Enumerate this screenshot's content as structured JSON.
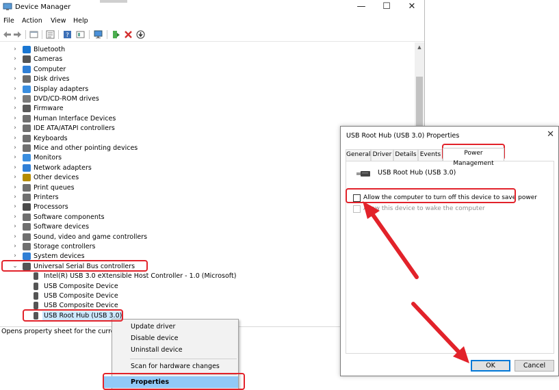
{
  "window": {
    "title": "Device Manager",
    "controls": {
      "minimize": "—",
      "maximize": "☐",
      "close": "✕"
    }
  },
  "menu": [
    "File",
    "Action",
    "View",
    "Help"
  ],
  "toolbar_icons": [
    "back-icon",
    "forward-icon",
    "view-icon",
    "properties-icon",
    "help-icon",
    "console-icon",
    "monitor-icon",
    "update-driver-icon",
    "uninstall-icon",
    "download-icon"
  ],
  "tree": {
    "categories": [
      {
        "label": "Bluetooth",
        "icon": "bluetooth-icon",
        "color": "#1976d2"
      },
      {
        "label": "Cameras",
        "icon": "camera-icon",
        "color": "#555555"
      },
      {
        "label": "Computer",
        "icon": "computer-icon",
        "color": "#2f7fd6"
      },
      {
        "label": "Disk drives",
        "icon": "disk-icon",
        "color": "#6b6b6b"
      },
      {
        "label": "Display adapters",
        "icon": "display-icon",
        "color": "#3a8ee0"
      },
      {
        "label": "DVD/CD-ROM drives",
        "icon": "dvd-icon",
        "color": "#7a7a7a"
      },
      {
        "label": "Firmware",
        "icon": "firmware-icon",
        "color": "#5a5a5a"
      },
      {
        "label": "Human Interface Devices",
        "icon": "hid-icon",
        "color": "#6f6f6f"
      },
      {
        "label": "IDE ATA/ATAPI controllers",
        "icon": "ide-icon",
        "color": "#6f6f6f"
      },
      {
        "label": "Keyboards",
        "icon": "keyboard-icon",
        "color": "#6f6f6f"
      },
      {
        "label": "Mice and other pointing devices",
        "icon": "mouse-icon",
        "color": "#6f6f6f"
      },
      {
        "label": "Monitors",
        "icon": "monitor-icon",
        "color": "#3a8ee0"
      },
      {
        "label": "Network adapters",
        "icon": "network-icon",
        "color": "#2f7fd6"
      },
      {
        "label": "Other devices",
        "icon": "other-device-icon",
        "color": "#b58c00"
      },
      {
        "label": "Print queues",
        "icon": "print-queue-icon",
        "color": "#6f6f6f"
      },
      {
        "label": "Printers",
        "icon": "printer-icon",
        "color": "#6f6f6f"
      },
      {
        "label": "Processors",
        "icon": "processor-icon",
        "color": "#4a4a4a"
      },
      {
        "label": "Software components",
        "icon": "software-component-icon",
        "color": "#6f6f6f"
      },
      {
        "label": "Software devices",
        "icon": "software-device-icon",
        "color": "#6f6f6f"
      },
      {
        "label": "Sound, video and game controllers",
        "icon": "sound-icon",
        "color": "#6f6f6f"
      },
      {
        "label": "Storage controllers",
        "icon": "storage-icon",
        "color": "#6f6f6f"
      },
      {
        "label": "System devices",
        "icon": "system-device-icon",
        "color": "#2f7fd6"
      },
      {
        "label": "Universal Serial Bus controllers",
        "icon": "usb-icon",
        "color": "#555555"
      }
    ],
    "usb_children": [
      "Intel(R) USB 3.0 eXtensible Host Controller - 1.0 (Microsoft)",
      "USB Composite Device",
      "USB Composite Device",
      "USB Composite Device",
      "USB Root Hub (USB 3.0)"
    ]
  },
  "status_text": "Opens property sheet for the current se",
  "context_menu": {
    "items": [
      "Update driver",
      "Disable device",
      "Uninstall device",
      "Scan for hardware changes",
      "Properties"
    ]
  },
  "dialog": {
    "title": "USB Root Hub (USB 3.0) Properties",
    "close": "✕",
    "tabs": [
      "General",
      "Driver",
      "Details",
      "Events",
      "Power Management"
    ],
    "active_tab": "Power Management",
    "device_name": "USB Root Hub (USB 3.0)",
    "options": [
      {
        "label": "Allow the computer to turn off this device to save power",
        "checked": false,
        "enabled": true
      },
      {
        "label": "Allow this device to wake the computer",
        "checked": false,
        "enabled": false
      }
    ],
    "ok_label": "OK",
    "cancel_label": "Cancel"
  },
  "colors": {
    "annotation": "#e2222a",
    "selection": "#cce8ff",
    "menu_highlight": "#91c9f7",
    "default_button_border": "#0078d7"
  }
}
